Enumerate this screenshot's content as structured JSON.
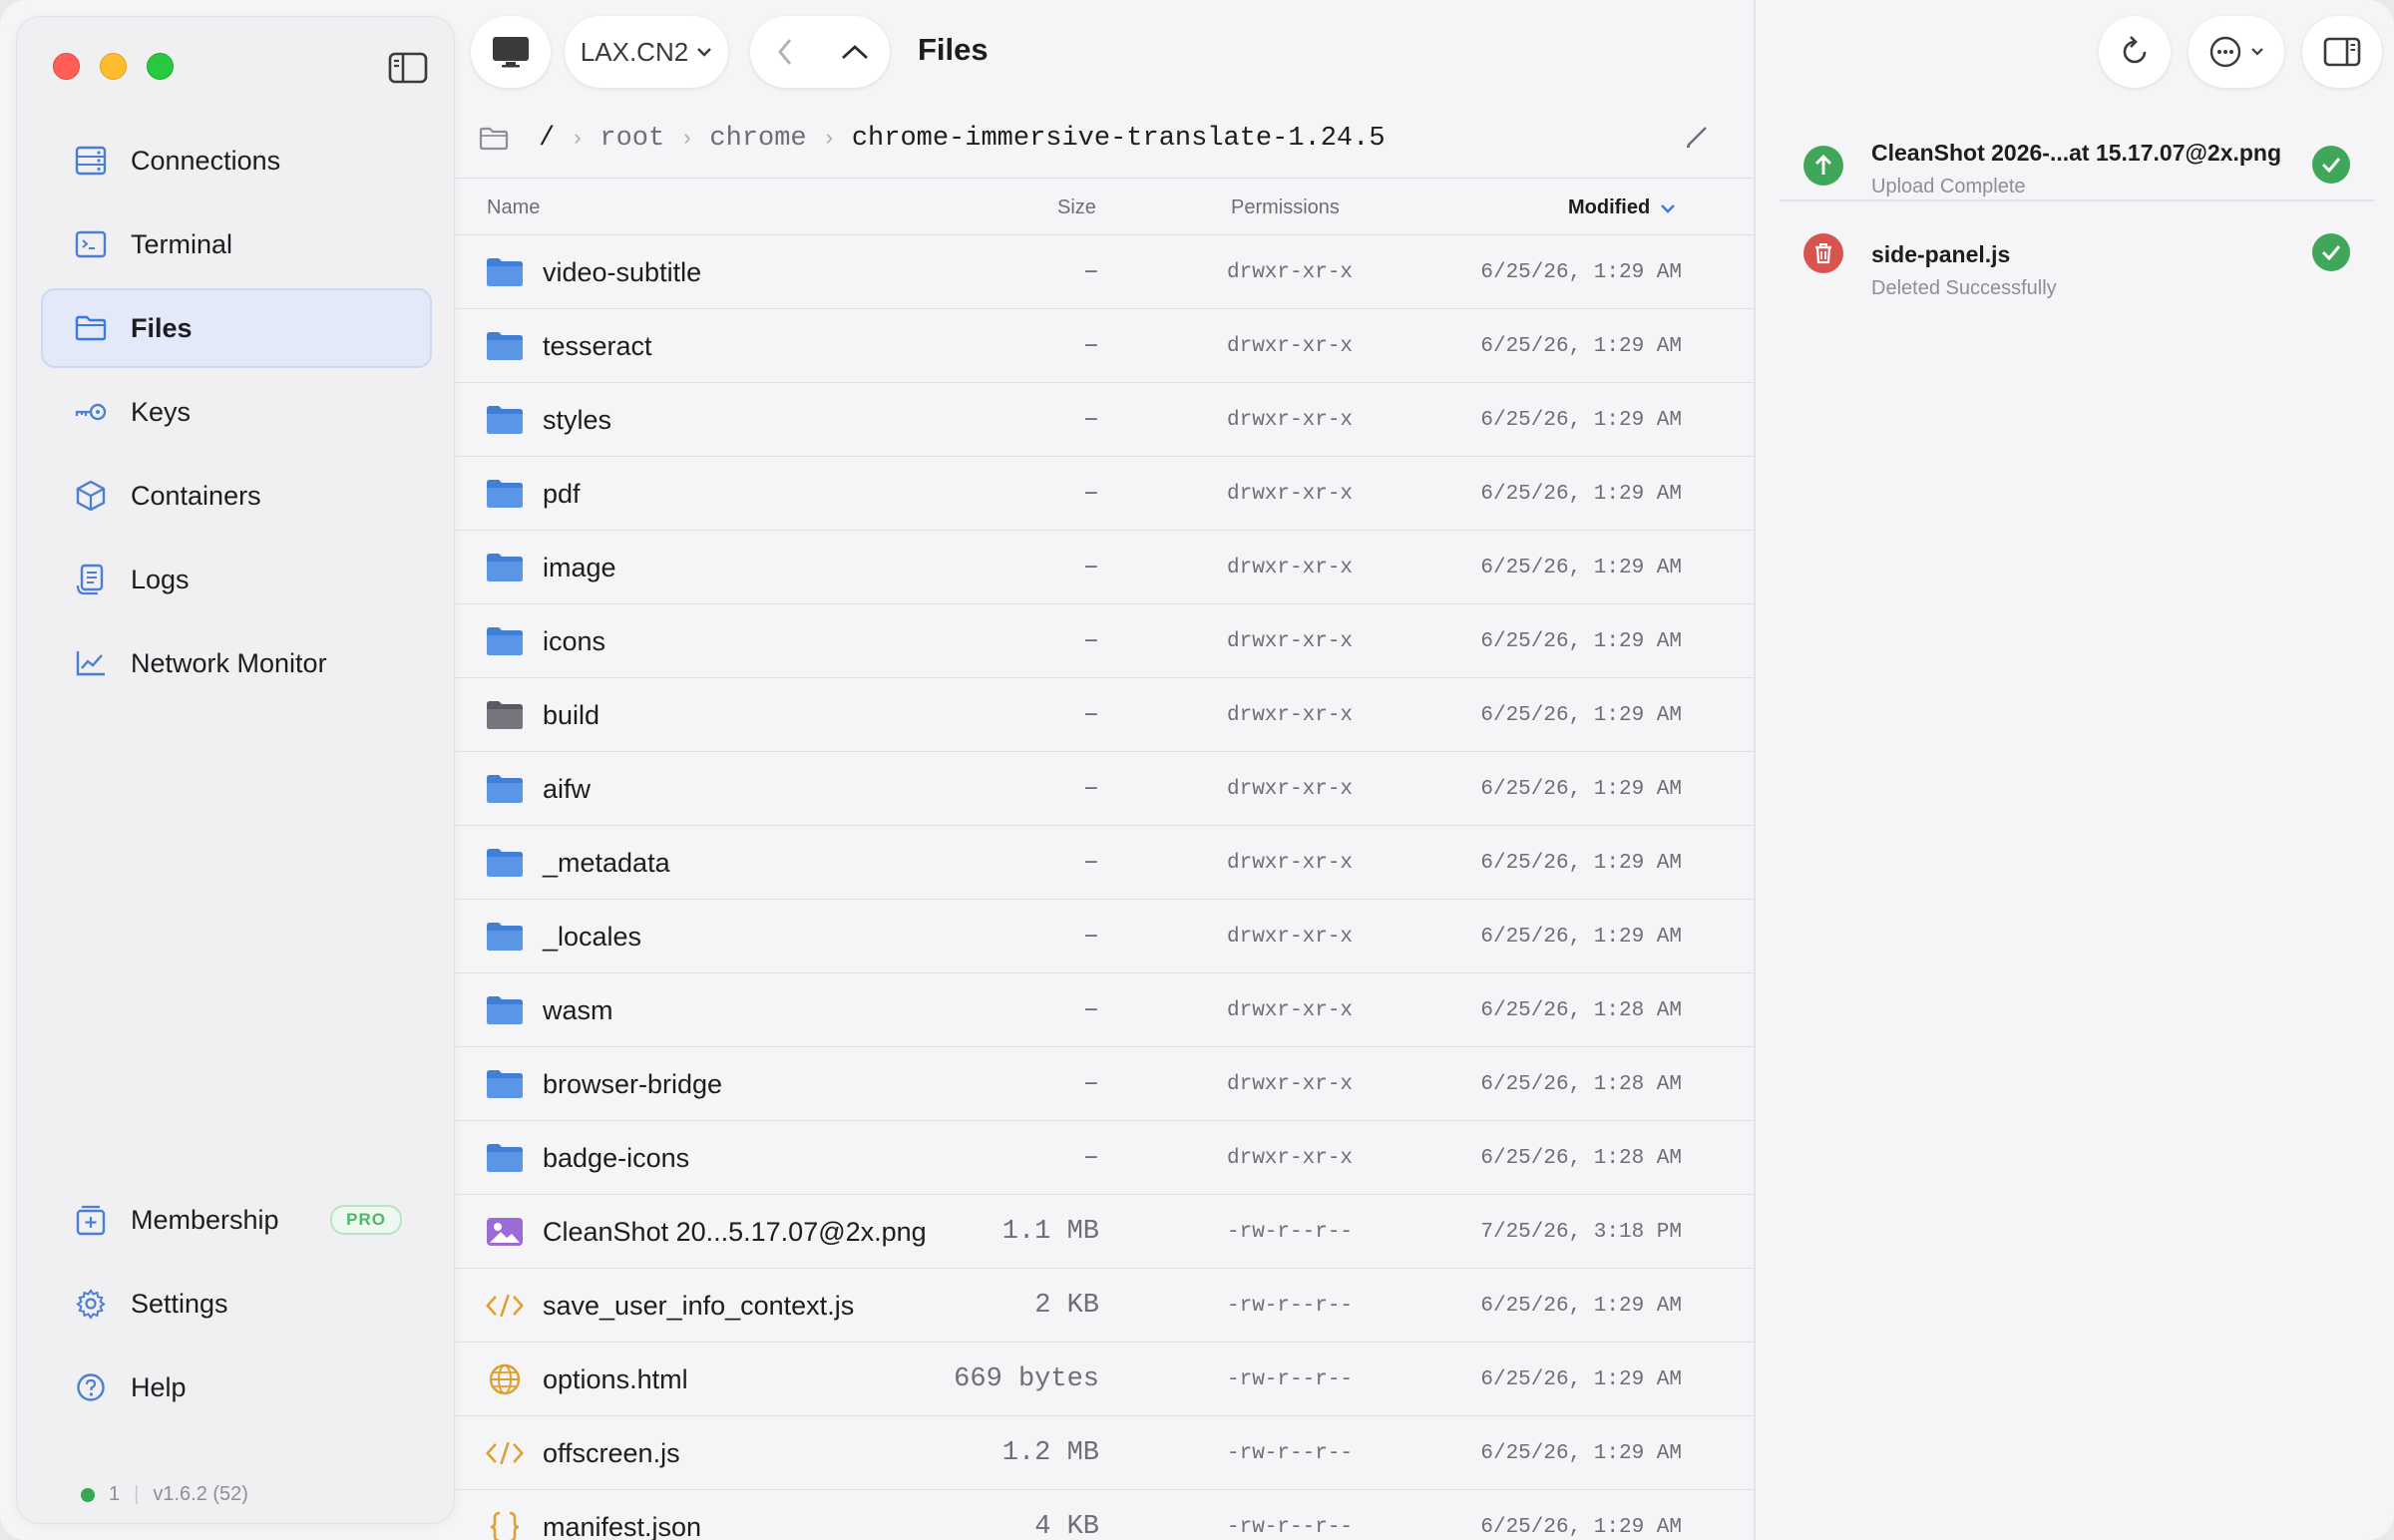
{
  "sidebar": {
    "items": [
      {
        "label": "Connections",
        "icon": "server-icon"
      },
      {
        "label": "Terminal",
        "icon": "terminal-icon"
      },
      {
        "label": "Files",
        "icon": "folder-icon",
        "active": true
      },
      {
        "label": "Keys",
        "icon": "key-icon"
      },
      {
        "label": "Containers",
        "icon": "container-icon"
      },
      {
        "label": "Logs",
        "icon": "logs-icon"
      },
      {
        "label": "Network Monitor",
        "icon": "chart-icon"
      }
    ],
    "bottom": [
      {
        "label": "Membership",
        "icon": "membership-icon",
        "badge": "PRO"
      },
      {
        "label": "Settings",
        "icon": "gear-icon"
      },
      {
        "label": "Help",
        "icon": "help-icon"
      }
    ],
    "status": {
      "count": "1",
      "version": "v1.6.2 (52)"
    }
  },
  "toolbar": {
    "server": "LAX.CN2",
    "title": "Files"
  },
  "breadcrumb": {
    "root": "/",
    "segments": [
      "root",
      "chrome"
    ],
    "current": "chrome-immersive-translate-1.24.5"
  },
  "table": {
    "headers": {
      "name": "Name",
      "size": "Size",
      "permissions": "Permissions",
      "modified": "Modified"
    },
    "rows": [
      {
        "name": "video-subtitle",
        "size": "–",
        "perm": "drwxr-xr-x",
        "modified": "6/25/26, 1:29 AM",
        "type": "folder"
      },
      {
        "name": "tesseract",
        "size": "–",
        "perm": "drwxr-xr-x",
        "modified": "6/25/26, 1:29 AM",
        "type": "folder"
      },
      {
        "name": "styles",
        "size": "–",
        "perm": "drwxr-xr-x",
        "modified": "6/25/26, 1:29 AM",
        "type": "folder"
      },
      {
        "name": "pdf",
        "size": "–",
        "perm": "drwxr-xr-x",
        "modified": "6/25/26, 1:29 AM",
        "type": "folder"
      },
      {
        "name": "image",
        "size": "–",
        "perm": "drwxr-xr-x",
        "modified": "6/25/26, 1:29 AM",
        "type": "folder"
      },
      {
        "name": "icons",
        "size": "–",
        "perm": "drwxr-xr-x",
        "modified": "6/25/26, 1:29 AM",
        "type": "folder"
      },
      {
        "name": "build",
        "size": "–",
        "perm": "drwxr-xr-x",
        "modified": "6/25/26, 1:29 AM",
        "type": "folder-dark"
      },
      {
        "name": "aifw",
        "size": "–",
        "perm": "drwxr-xr-x",
        "modified": "6/25/26, 1:29 AM",
        "type": "folder"
      },
      {
        "name": "_metadata",
        "size": "–",
        "perm": "drwxr-xr-x",
        "modified": "6/25/26, 1:29 AM",
        "type": "folder"
      },
      {
        "name": "_locales",
        "size": "–",
        "perm": "drwxr-xr-x",
        "modified": "6/25/26, 1:29 AM",
        "type": "folder"
      },
      {
        "name": "wasm",
        "size": "–",
        "perm": "drwxr-xr-x",
        "modified": "6/25/26, 1:28 AM",
        "type": "folder"
      },
      {
        "name": "browser-bridge",
        "size": "–",
        "perm": "drwxr-xr-x",
        "modified": "6/25/26, 1:28 AM",
        "type": "folder"
      },
      {
        "name": "badge-icons",
        "size": "–",
        "perm": "drwxr-xr-x",
        "modified": "6/25/26, 1:28 AM",
        "type": "folder"
      },
      {
        "name": "CleanShot 20...5.17.07@2x.png",
        "size": "1.1 MB",
        "perm": "-rw-r--r--",
        "modified": "7/25/26, 3:18 PM",
        "type": "image"
      },
      {
        "name": "save_user_info_context.js",
        "size": "2 KB",
        "perm": "-rw-r--r--",
        "modified": "6/25/26, 1:29 AM",
        "type": "code"
      },
      {
        "name": "options.html",
        "size": "669 bytes",
        "perm": "-rw-r--r--",
        "modified": "6/25/26, 1:29 AM",
        "type": "web"
      },
      {
        "name": "offscreen.js",
        "size": "1.2 MB",
        "perm": "-rw-r--r--",
        "modified": "6/25/26, 1:29 AM",
        "type": "code"
      },
      {
        "name": "manifest.json",
        "size": "4 KB",
        "perm": "-rw-r--r--",
        "modified": "6/25/26, 1:29 AM",
        "type": "json"
      }
    ]
  },
  "notifications": [
    {
      "title": "CleanShot 2026-...at 15.17.07@2x.png",
      "subtitle": "Upload Complete",
      "kind": "upload",
      "color": "#3fa65a"
    },
    {
      "title": "side-panel.js",
      "subtitle": "Deleted Successfully",
      "kind": "delete",
      "color": "#d9534f"
    }
  ],
  "colors": {
    "accent": "#3b7be0",
    "folder": "#4a86dc",
    "success": "#3fa65a",
    "danger": "#d9534f"
  }
}
